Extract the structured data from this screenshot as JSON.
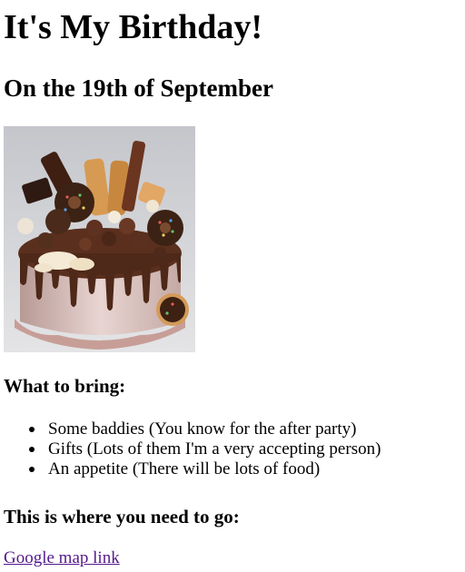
{
  "page": {
    "title": "It's My Birthday!",
    "subtitle": "On the 19th of September",
    "bring_heading": "What to bring:",
    "bring_items": [
      "Some baddies (You know for the after party)",
      "Gifts (Lots of them I'm a very accepting person)",
      "An appetite (There will be lots of food)"
    ],
    "location_heading": "This is where you need to go:",
    "map_link_text": "Google map link"
  },
  "colors": {
    "link_visited": "#551a8b",
    "text": "#000000",
    "background": "#ffffff"
  },
  "icons": {
    "cake_image": "chocolate-drip-cake-image"
  }
}
